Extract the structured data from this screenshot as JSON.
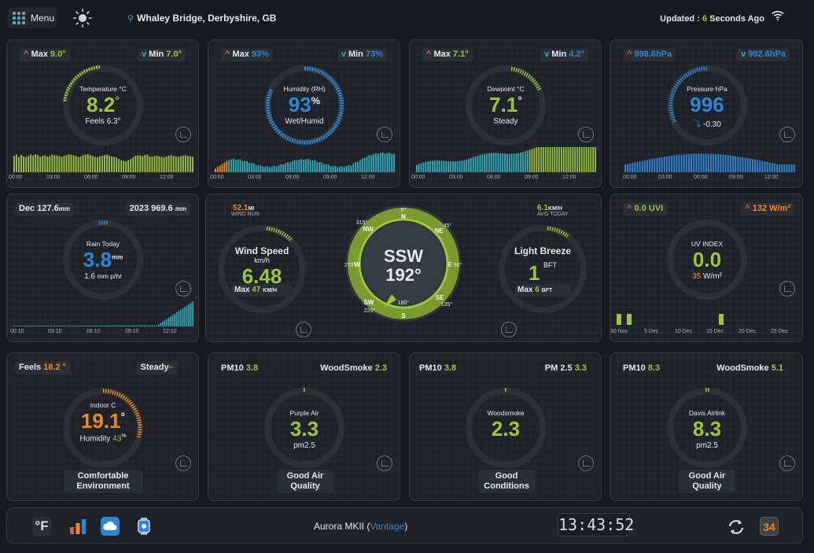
{
  "topbar": {
    "menu_label": "Menu",
    "location": "Whaley Bridge, Derbyshire, GB",
    "updated_prefix": "Updated : ",
    "updated_value": "6",
    "updated_suffix": " Seconds Ago"
  },
  "temperature": {
    "max_label": "Max",
    "max_value": "9.0°",
    "min_label": "Min",
    "min_value": "7.0°",
    "title": "Temperature °C",
    "value": "8.2",
    "unit": "°",
    "feels": "Feels 6.3°",
    "bars": [
      0.75,
      0.8,
      0.7,
      0.78,
      0.72,
      0.7,
      0.74,
      0.8,
      0.77,
      0.82,
      0.78,
      0.7,
      0.75,
      0.76,
      0.72,
      0.74,
      0.8,
      0.78,
      0.76,
      0.74,
      0.7,
      0.75,
      0.78,
      0.82,
      0.8,
      0.77,
      0.74,
      0.7,
      0.72,
      0.78,
      0.8,
      0.82,
      0.79,
      0.74,
      0.7,
      0.68,
      0.72,
      0.75,
      0.78,
      0.8,
      0.76,
      0.72,
      0.7,
      0.68,
      0.6,
      0.55,
      0.52,
      0.5,
      0.55,
      0.6,
      0.68,
      0.75,
      0.78,
      0.76,
      0.74,
      0.78,
      0.8,
      0.72,
      0.7,
      0.74,
      0.75,
      0.72,
      0.7,
      0.68,
      0.72,
      0.75,
      0.78,
      0.74,
      0.72,
      0.7,
      0.74,
      0.76,
      0.78,
      0.74,
      0.72,
      0.7
    ],
    "ticks": [
      "00:00",
      "03:00",
      "06:00",
      "09:00",
      "12:00"
    ]
  },
  "humidity": {
    "max_label": "Max",
    "max_value": "93%",
    "min_label": "Min",
    "min_value": "73%",
    "title": "Humidity (RH)",
    "value": "93",
    "unit": "%",
    "status": "Wet/Humid",
    "ticks": [
      "00:00",
      "03:00",
      "06:00",
      "09:00",
      "12:00"
    ]
  },
  "dewpoint": {
    "max_label": "Max",
    "max_value": "7.1°",
    "min_label": "Min",
    "min_value": "4.2°",
    "title": "Dewpoint °C",
    "value": "7.1",
    "unit": "°",
    "status": "Steady",
    "ticks": [
      "00:00",
      "03:00",
      "06:00",
      "09:00",
      "12:00"
    ]
  },
  "pressure": {
    "max_value": "998.6hPa",
    "min_value": "992.6hPa",
    "title": "Pressure hPa",
    "value": "996",
    "trend": "-0.30",
    "ticks": [
      "00:00",
      "03:00",
      "06:00",
      "09:00",
      "12:00"
    ]
  },
  "rain": {
    "month": "Dec 127.6",
    "month_unit": "mm",
    "year": "2023 969.6",
    "year_unit": "mm",
    "title": "Rain Today",
    "value": "3.8",
    "unit": "mm",
    "rate_value": "1.6",
    "rate_unit": "mm p/hr",
    "ticks": [
      "00:10",
      "03:10",
      "06:10",
      "09:10",
      "12:10"
    ]
  },
  "wind": {
    "run_value": "52.1",
    "run_unit": "MI",
    "run_label": "WIND RUN",
    "avg_value": "6.1",
    "avg_unit": "KM/H",
    "avg_label": "AVG TODAY",
    "speed_title": "Wind Speed",
    "speed_unit": "km/h",
    "speed_value": "6.48",
    "speed_max_label": "Max",
    "speed_max_value": "47",
    "speed_max_unit": "KM/H",
    "direction": "SSW",
    "degrees": "192°",
    "compass": [
      "0°",
      "N",
      "45°",
      "NE",
      "90°",
      "E",
      "135°",
      "SE",
      "180°",
      "S",
      "225°",
      "SW",
      "270°",
      "W",
      "315°",
      "NW"
    ],
    "beaufort_title": "Light Breeze",
    "beaufort_value": "1",
    "beaufort_unit": "BFT",
    "bft_max_label": "Max",
    "bft_max_value": "6",
    "bft_max_unit": "BFT"
  },
  "uv": {
    "uvi_value": "0.0 UVI",
    "solar_value": "132 W/m²",
    "title": "UV INDEX",
    "value": "0.0",
    "solar_now": "35",
    "solar_unit": "W/m²",
    "ticks": [
      "30 Nov",
      "5 Dec",
      "10 Dec",
      "15 Dec",
      "20 Dec",
      "25 Dec"
    ]
  },
  "indoor": {
    "feels_label": "Feels",
    "feels_value": "18.2 °",
    "trend": "Steady",
    "title": "Indoor C",
    "value": "19.1",
    "unit": "°",
    "humidity_label": "Humidity",
    "humidity_value": "43",
    "humidity_unit": "%",
    "status_line1": "Comfortable",
    "status_line2": "Environment"
  },
  "purple_air": {
    "left_label": "PM10",
    "left_value": "3.8",
    "right_label": "WoodSmoke",
    "right_value": "2.3",
    "title": "Purple Air",
    "value": "3.3",
    "unit": "pm2.5",
    "status_line1": "Good Air",
    "status_line2": "Quality"
  },
  "woodsmoke": {
    "left_label": "PM10",
    "left_value": "3.8",
    "right_label": "PM 2.5",
    "right_value": "3.3",
    "title": "Woodsmoke",
    "value": "2.3",
    "status_line1": "Good",
    "status_line2": "Conditions"
  },
  "airlink": {
    "left_label": "PM10",
    "left_value": "8.3",
    "right_label": "WoodSmoke",
    "right_value": "5.1",
    "title": "Davis Airlink",
    "value": "8.3",
    "unit": "pm2.5",
    "status_line1": "Good Air",
    "status_line2": "Quality"
  },
  "footer": {
    "units_label": "°F",
    "model_prefix": "Aurora MKII (",
    "model_brand": "Vantage",
    "model_suffix": ")",
    "clock": "13:43:52",
    "calendar_day": "34"
  },
  "colors": {
    "green": "#9bc53d",
    "blue": "#2f86d6",
    "orange": "#f08a1e",
    "teal": "#2ab3c4",
    "red": "#e05555"
  }
}
